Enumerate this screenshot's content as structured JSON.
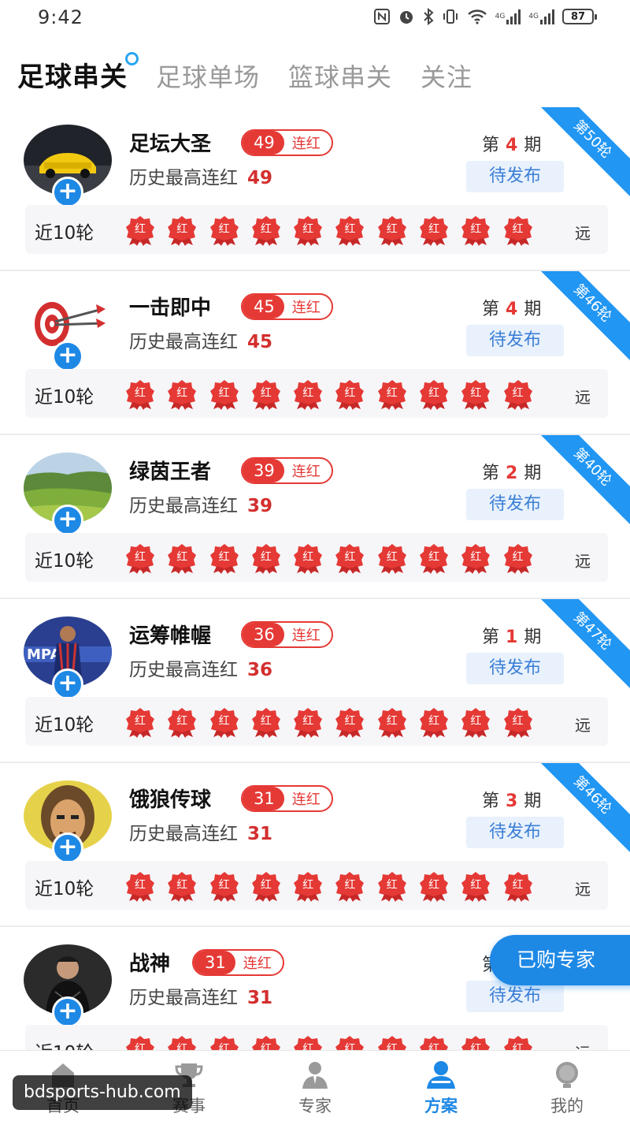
{
  "status_bar": {
    "time": "9:42",
    "net1": "4G",
    "net2": "4G",
    "battery": "87"
  },
  "top_tabs": [
    {
      "label": "足球串关",
      "active": true
    },
    {
      "label": "足球单场",
      "active": false
    },
    {
      "label": "篮球串关",
      "active": false
    },
    {
      "label": "关注",
      "active": false
    }
  ],
  "common": {
    "streak_label": "连红",
    "history_label": "历史最高连红",
    "period_prefix": "第",
    "period_suffix": "期",
    "publish_label": "待发布",
    "recent_label": "近10轮",
    "badge_text": "红",
    "far_label": "远"
  },
  "experts": [
    {
      "name": "足坛大圣",
      "streak": "49",
      "history": "49",
      "period": "4",
      "ribbon": "第50轮"
    },
    {
      "name": "一击即中",
      "streak": "45",
      "history": "45",
      "period": "4",
      "ribbon": "第46轮"
    },
    {
      "name": "绿茵王者",
      "streak": "39",
      "history": "39",
      "period": "2",
      "ribbon": "第40轮"
    },
    {
      "name": "运筹帷幄",
      "streak": "36",
      "history": "36",
      "period": "1",
      "ribbon": "第47轮"
    },
    {
      "name": "饿狼传球",
      "streak": "31",
      "history": "31",
      "period": "3",
      "ribbon": "第46轮"
    },
    {
      "name": "战神",
      "streak": "31",
      "history": "31",
      "period": "",
      "ribbon": ""
    }
  ],
  "floating_button": "已购专家",
  "bottom_nav": [
    {
      "label": "首页",
      "icon": "home-icon",
      "active": false
    },
    {
      "label": "赛事",
      "icon": "trophy-icon",
      "active": false
    },
    {
      "label": "专家",
      "icon": "expert-icon",
      "active": false
    },
    {
      "label": "方案",
      "icon": "plan-icon",
      "active": true
    },
    {
      "label": "我的",
      "icon": "profile-icon",
      "active": false
    }
  ],
  "watermark": "bdsports-hub.com",
  "colors": {
    "accent": "#1e88e5",
    "red": "#e53935",
    "ribbon": "#2196f3"
  }
}
